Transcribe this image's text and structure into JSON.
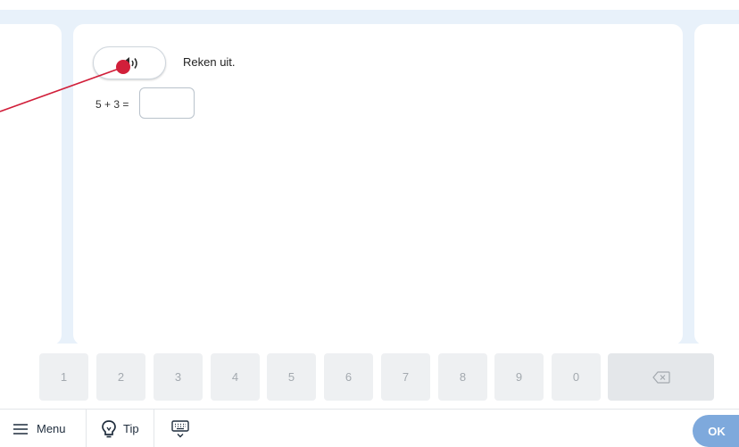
{
  "exercise": {
    "instruction": "Reken uit.",
    "equation": "5 + 3 =",
    "answer_value": "",
    "audio_icon": "speaker-icon"
  },
  "keypad": {
    "keys": [
      "1",
      "2",
      "3",
      "4",
      "5",
      "6",
      "7",
      "8",
      "9",
      "0"
    ],
    "backspace_icon": "backspace-icon"
  },
  "toolbar": {
    "menu_label": "Menu",
    "menu_icon": "hamburger-icon",
    "tip_label": "Tip",
    "tip_icon": "lightbulb-icon",
    "keyboard_icon": "keyboard-icon",
    "ok_label": "OK"
  },
  "colors": {
    "background": "#e8f1fa",
    "ok_button": "#7ea9dc",
    "pointer": "#d11f3a",
    "key": "#eef0f2"
  }
}
